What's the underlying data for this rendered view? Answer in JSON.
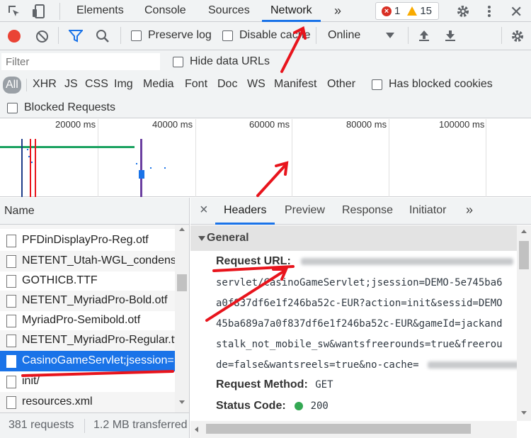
{
  "topbar": {
    "tabs": [
      "Elements",
      "Console",
      "Sources",
      "Network"
    ],
    "more": "»",
    "errors": "1",
    "warnings": "15"
  },
  "toolbar": {
    "preserve_log": "Preserve log",
    "disable_cache": "Disable cache",
    "throttling": "Online"
  },
  "filter": {
    "placeholder": "Filter",
    "hide_data_urls": "Hide data URLs",
    "types": [
      "All",
      "XHR",
      "JS",
      "CSS",
      "Img",
      "Media",
      "Font",
      "Doc",
      "WS",
      "Manifest",
      "Other"
    ],
    "has_blocked_cookies": "Has blocked cookies",
    "blocked_requests": "Blocked Requests"
  },
  "overview": {
    "ticks": [
      "20000 ms",
      "40000 ms",
      "60000 ms",
      "80000 ms",
      "100000 ms"
    ]
  },
  "requests": {
    "header": "Name",
    "items": [
      "PFDinDisplayPro-Reg.otf",
      "NETENT_Utah-WGL_condensed",
      "GOTHICB.TTF",
      "NETENT_MyriadPro-Bold.otf",
      "MyriadPro-Semibold.otf",
      "NETENT_MyriadPro-Regular.ttf",
      "CasinoGameServlet;jsession=...",
      "init/",
      "resources.xml"
    ],
    "selected_index": 6,
    "footer_requests": "381 requests",
    "footer_transferred": "1.2 MB transferred"
  },
  "details": {
    "close": "×",
    "tabs": [
      "Headers",
      "Preview",
      "Response",
      "Initiator"
    ],
    "more": "»",
    "section": "General",
    "request_url_label": "Request URL:",
    "url_lines": [
      "servlet/CasinoGameServlet;jsession=DEMO-5e745ba6",
      "a0f837df6e1f246ba52c-EUR?action=init&sessid=DEMO",
      "45ba689a7a0f837df6e1f246ba52c-EUR&gameId=jackand",
      "stalk_not_mobile_sw&wantsfreerounds=true&freerou",
      "de=false&wantsreels=true&no-cache="
    ],
    "request_method_label": "Request Method:",
    "request_method": "GET",
    "status_code_label": "Status Code:",
    "status_code": "200"
  },
  "colors": {
    "accent": "#1a73e8",
    "record": "#ea4335",
    "annotation": "#e8141c",
    "status_ok": "#34a853"
  }
}
